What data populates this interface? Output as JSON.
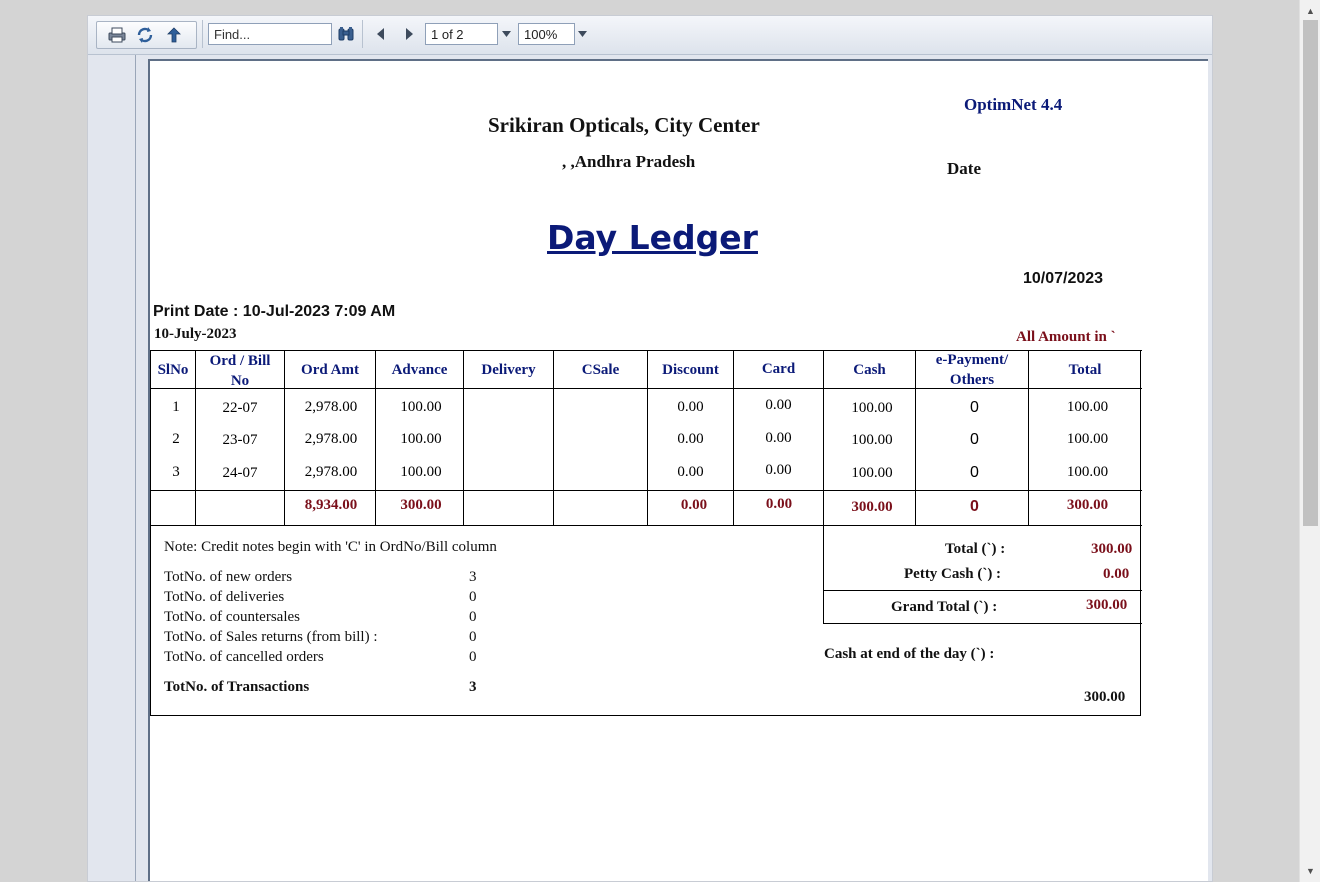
{
  "toolbar": {
    "find_placeholder": "Find...",
    "page_indicator": "1 of 2",
    "zoom": "100%"
  },
  "report": {
    "version": "OptimNet 4.4",
    "company": "Srikiran Opticals, City Center",
    "address": ", ,Andhra Pradesh",
    "date_label": "Date",
    "title": "Day Ledger",
    "date_value": "10/07/2023",
    "print_date": "Print Date : 10-Jul-2023  7:09 AM",
    "report_date": "10-July-2023",
    "amount_note": "All Amount in `",
    "columns": {
      "slno": "SlNo",
      "ord_bill_1": "Ord / Bill",
      "ord_bill_2": "No",
      "ord_amt": "Ord Amt",
      "advance": "Advance",
      "delivery": "Delivery",
      "csale": "CSale",
      "discount": "Discount",
      "card": "Card",
      "cash": "Cash",
      "epay_1": "e-Payment/",
      "epay_2": "Others",
      "total": "Total"
    },
    "rows": [
      {
        "slno": "1",
        "bill": "22-07",
        "ord_amt": "2,978.00",
        "advance": "100.00",
        "delivery": "",
        "csale": "",
        "discount": "0.00",
        "card": "0.00",
        "cash": "100.00",
        "epay": "0",
        "total": "100.00"
      },
      {
        "slno": "2",
        "bill": "23-07",
        "ord_amt": "2,978.00",
        "advance": "100.00",
        "delivery": "",
        "csale": "",
        "discount": "0.00",
        "card": "0.00",
        "cash": "100.00",
        "epay": "0",
        "total": "100.00"
      },
      {
        "slno": "3",
        "bill": "24-07",
        "ord_amt": "2,978.00",
        "advance": "100.00",
        "delivery": "",
        "csale": "",
        "discount": "0.00",
        "card": "0.00",
        "cash": "100.00",
        "epay": "0",
        "total": "100.00"
      }
    ],
    "totals": {
      "ord_amt": "8,934.00",
      "advance": "300.00",
      "discount": "0.00",
      "card": "0.00",
      "cash": "300.00",
      "epay": "0",
      "total": "300.00"
    },
    "note": "Note: Credit notes begin with 'C' in OrdNo/Bill column",
    "stats": [
      {
        "label": "TotNo. of new orders",
        "value": "3"
      },
      {
        "label": "TotNo. of deliveries",
        "value": "0"
      },
      {
        "label": "TotNo. of countersales",
        "value": "0"
      },
      {
        "label": "TotNo. of Sales returns (from bill) :",
        "value": "0"
      },
      {
        "label": "TotNo. of cancelled orders",
        "value": "0"
      }
    ],
    "transactions_label": "TotNo. of Transactions",
    "transactions_value": "3",
    "summary": {
      "total_label": "Total (`) :",
      "total_value": "300.00",
      "petty_label": "Petty Cash (`) :",
      "petty_value": "0.00",
      "grand_label": "Grand Total (`) :",
      "grand_value": "300.00",
      "cash_end_label": "Cash at end of the day (`) :",
      "cash_end_value": "300.00"
    }
  }
}
